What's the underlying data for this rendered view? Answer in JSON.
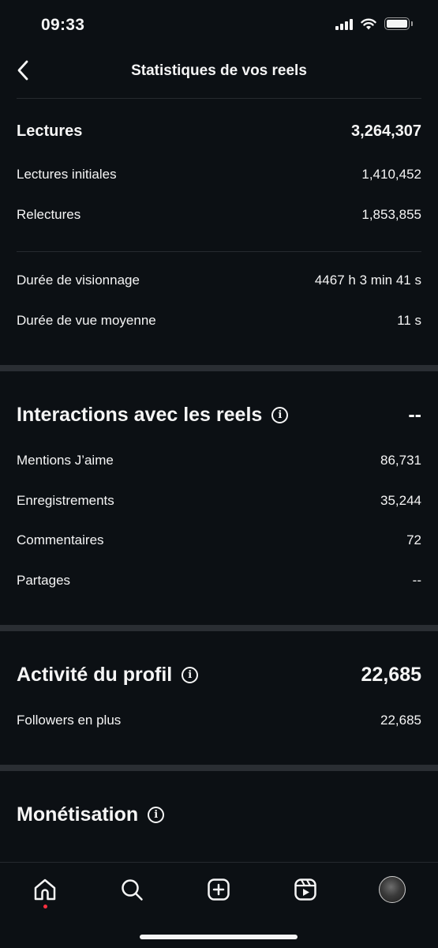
{
  "status_bar": {
    "time": "09:33"
  },
  "header": {
    "title": "Statistiques de vos reels"
  },
  "lectures": {
    "label": "Lectures",
    "value": "3,264,307",
    "rows": [
      {
        "label": "Lectures initiales",
        "value": "1,410,452"
      },
      {
        "label": "Relectures",
        "value": "1,853,855"
      }
    ],
    "watch": [
      {
        "label": "Durée de visionnage",
        "value": "4467 h 3 min 41 s"
      },
      {
        "label": "Durée de vue moyenne",
        "value": "11 s"
      }
    ]
  },
  "interactions": {
    "label": "Interactions avec les reels",
    "value": "--",
    "rows": [
      {
        "label": "Mentions J’aime",
        "value": "86,731"
      },
      {
        "label": "Enregistrements",
        "value": "35,244"
      },
      {
        "label": "Commentaires",
        "value": "72"
      },
      {
        "label": "Partages",
        "value": "--"
      }
    ]
  },
  "profile_activity": {
    "label": "Activité du profil",
    "value": "22,685",
    "rows": [
      {
        "label": "Followers en plus",
        "value": "22,685"
      }
    ]
  },
  "monetisation": {
    "label": "Monétisation"
  },
  "bottom_nav": {
    "items": [
      {
        "icon": "home-icon"
      },
      {
        "icon": "search-icon"
      },
      {
        "icon": "create-icon"
      },
      {
        "icon": "reels-icon"
      },
      {
        "icon": "profile-avatar"
      }
    ]
  },
  "colors": {
    "background": "#0c1014",
    "text": "#f5f5f5",
    "separator": "#2a2e33",
    "notification_dot": "#ff3040"
  }
}
